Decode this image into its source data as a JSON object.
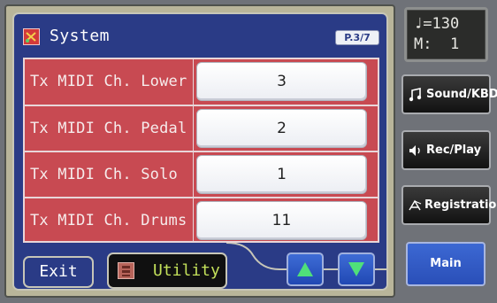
{
  "header": {
    "title": "System",
    "page": "P.3/7",
    "icon": "system-icon"
  },
  "rows": [
    {
      "label": "Tx MIDI Ch. Lower",
      "value": "3"
    },
    {
      "label": "Tx MIDI Ch. Pedal",
      "value": "2"
    },
    {
      "label": "Tx MIDI Ch. Solo",
      "value": "1"
    },
    {
      "label": "Tx MIDI Ch. Drums",
      "value": "11"
    }
  ],
  "footer": {
    "exit_label": "Exit",
    "utility_label": "Utility",
    "up_icon": "up-arrow-icon",
    "down_icon": "down-arrow-icon"
  },
  "tempo": {
    "line1": "♩=130",
    "line2": "M:  1"
  },
  "side": {
    "sound": "Sound/KBD",
    "rec": "Rec/Play",
    "registration": "Registration",
    "main": "Main"
  },
  "colors": {
    "screen_bg": "#2a3b86",
    "row_bg": "#c84a52",
    "accent_blue": "#2048b4",
    "utility_text": "#c3e05a"
  }
}
